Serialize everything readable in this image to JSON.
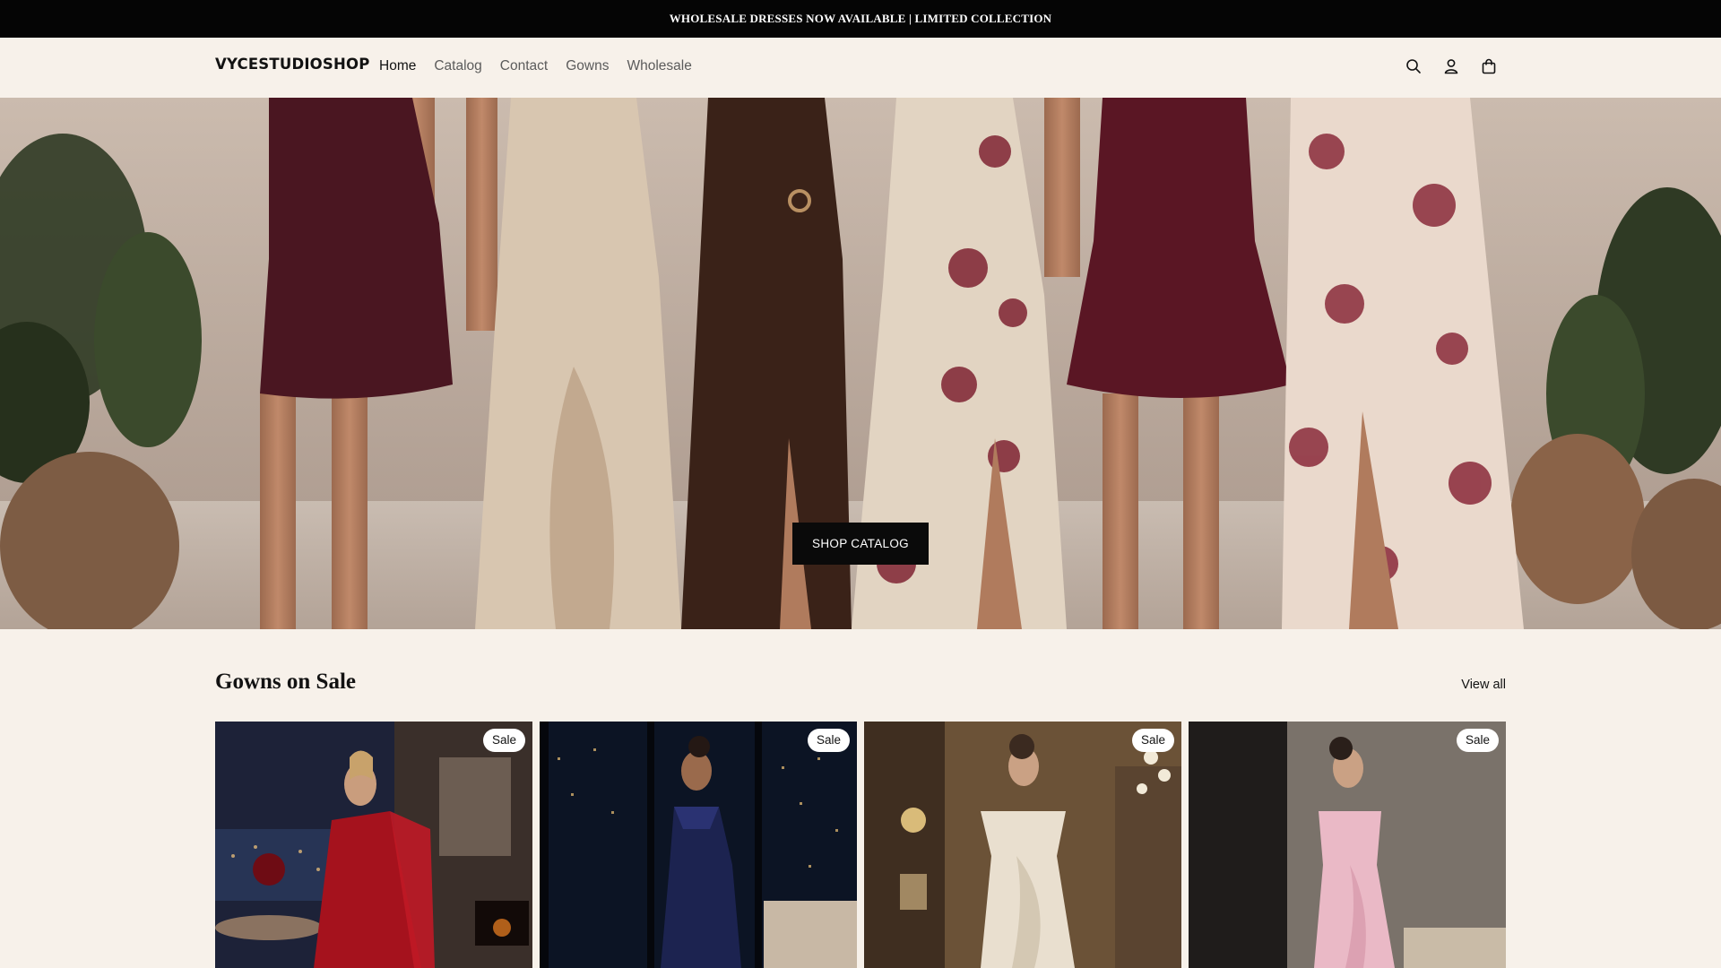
{
  "announcement": {
    "text": "WHOLESALE DRESSES NOW AVAILABLE | LIMITED COLLECTION"
  },
  "header": {
    "logo": "VYCESTUDIOSHOP",
    "nav": [
      {
        "label": "Home",
        "active": true
      },
      {
        "label": "Catalog",
        "active": false
      },
      {
        "label": "Contact",
        "active": false
      },
      {
        "label": "Gowns",
        "active": false
      },
      {
        "label": "Wholesale",
        "active": false
      }
    ],
    "icons": [
      "search-icon",
      "account-icon",
      "cart-icon"
    ]
  },
  "hero": {
    "cta_label": "SHOP CATALOG",
    "dress_colors": [
      "#4a1621",
      "#d8c6b0",
      "#3a2218",
      "#e2d4c2",
      "#5a1624",
      "#ead9cc"
    ]
  },
  "sale_section": {
    "title": "Gowns on Sale",
    "view_all_label": "View all",
    "products": [
      {
        "badge": "Sale",
        "gown_color": "#a5121d",
        "backdrop": "#1d2238"
      },
      {
        "badge": "Sale",
        "gown_color": "#1c2350",
        "backdrop": "#0c1424"
      },
      {
        "badge": "Sale",
        "gown_color": "#e9dfcf",
        "backdrop": "#6b5237"
      },
      {
        "badge": "Sale",
        "gown_color": "#eab9c6",
        "backdrop": "#3a3735"
      }
    ]
  },
  "colors": {
    "announcement_bg": "#050505",
    "page_bg": "#f7f1ea",
    "button_bg": "#0a0a0a",
    "text": "#121212"
  }
}
